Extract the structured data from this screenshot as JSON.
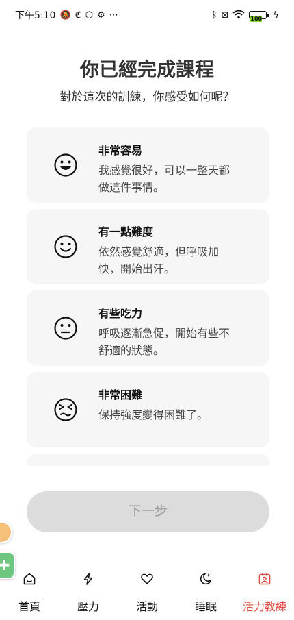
{
  "status_bar": {
    "time": "下午5:10",
    "battery": "100",
    "colors": {
      "battery_fill": "#7ed321"
    }
  },
  "header": {
    "title": "你已經完成課程",
    "subtitle": "對於這次的訓練，你感受如何呢？"
  },
  "options": [
    {
      "icon": "laughing-face-icon",
      "title": "非常容易",
      "description": "我感覺很好，可以一整天都做這件事情。"
    },
    {
      "icon": "smiling-face-icon",
      "title": "有一點難度",
      "description": "依然感覺舒適，但呼吸加快，開始出汗。"
    },
    {
      "icon": "neutral-face-icon",
      "title": "有些吃力",
      "description": "呼吸逐漸急促，開始有些不舒適的狀態。"
    },
    {
      "icon": "squinting-face-icon",
      "title": "非常困難",
      "description": "保持強度變得困難了。"
    }
  ],
  "next_button": {
    "label": "下一步"
  },
  "bottom_nav": {
    "active_color": "#e0473c",
    "items": [
      {
        "icon": "home-icon",
        "label": "首頁"
      },
      {
        "icon": "lightning-icon",
        "label": "壓力"
      },
      {
        "icon": "heart-icon",
        "label": "活動"
      },
      {
        "icon": "moon-icon",
        "label": "睡眠"
      },
      {
        "icon": "coach-icon",
        "label": "活力教練",
        "active": true
      }
    ]
  }
}
